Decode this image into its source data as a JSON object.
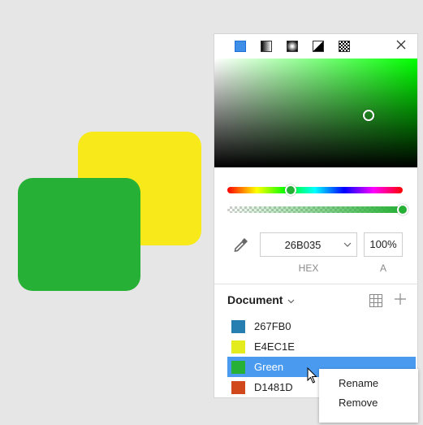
{
  "canvas": {
    "shapes": [
      {
        "name": "yellow-rectangle",
        "color": "#F8EA1A"
      },
      {
        "name": "green-rectangle",
        "color": "#26B035"
      }
    ]
  },
  "color_panel": {
    "fill_types": [
      "solid-icon",
      "linear-gradient-icon",
      "radial-gradient-icon",
      "angular-gradient-icon",
      "pattern-icon"
    ],
    "active_fill_type": "solid",
    "close_icon": "close-icon",
    "hue_level": 0.36,
    "alpha_level": 1.0,
    "hex_value": "26B035",
    "hex_label": "HEX",
    "alpha_value": "100%",
    "alpha_label": "A",
    "current_color": "#26B035"
  },
  "swatches": {
    "header": "Document",
    "header_chevron": "⌵",
    "items": [
      {
        "label": "267FB0",
        "color": "#267FB0",
        "selected": false
      },
      {
        "label": "E4EC1E",
        "color": "#E4EC1E",
        "selected": false
      },
      {
        "label": "Green",
        "color": "#26B035",
        "selected": true
      },
      {
        "label": "D1481D",
        "color": "#D1481D",
        "selected": false
      }
    ]
  },
  "context_menu": {
    "items": [
      {
        "label": "Rename"
      },
      {
        "label": "Remove"
      }
    ]
  }
}
